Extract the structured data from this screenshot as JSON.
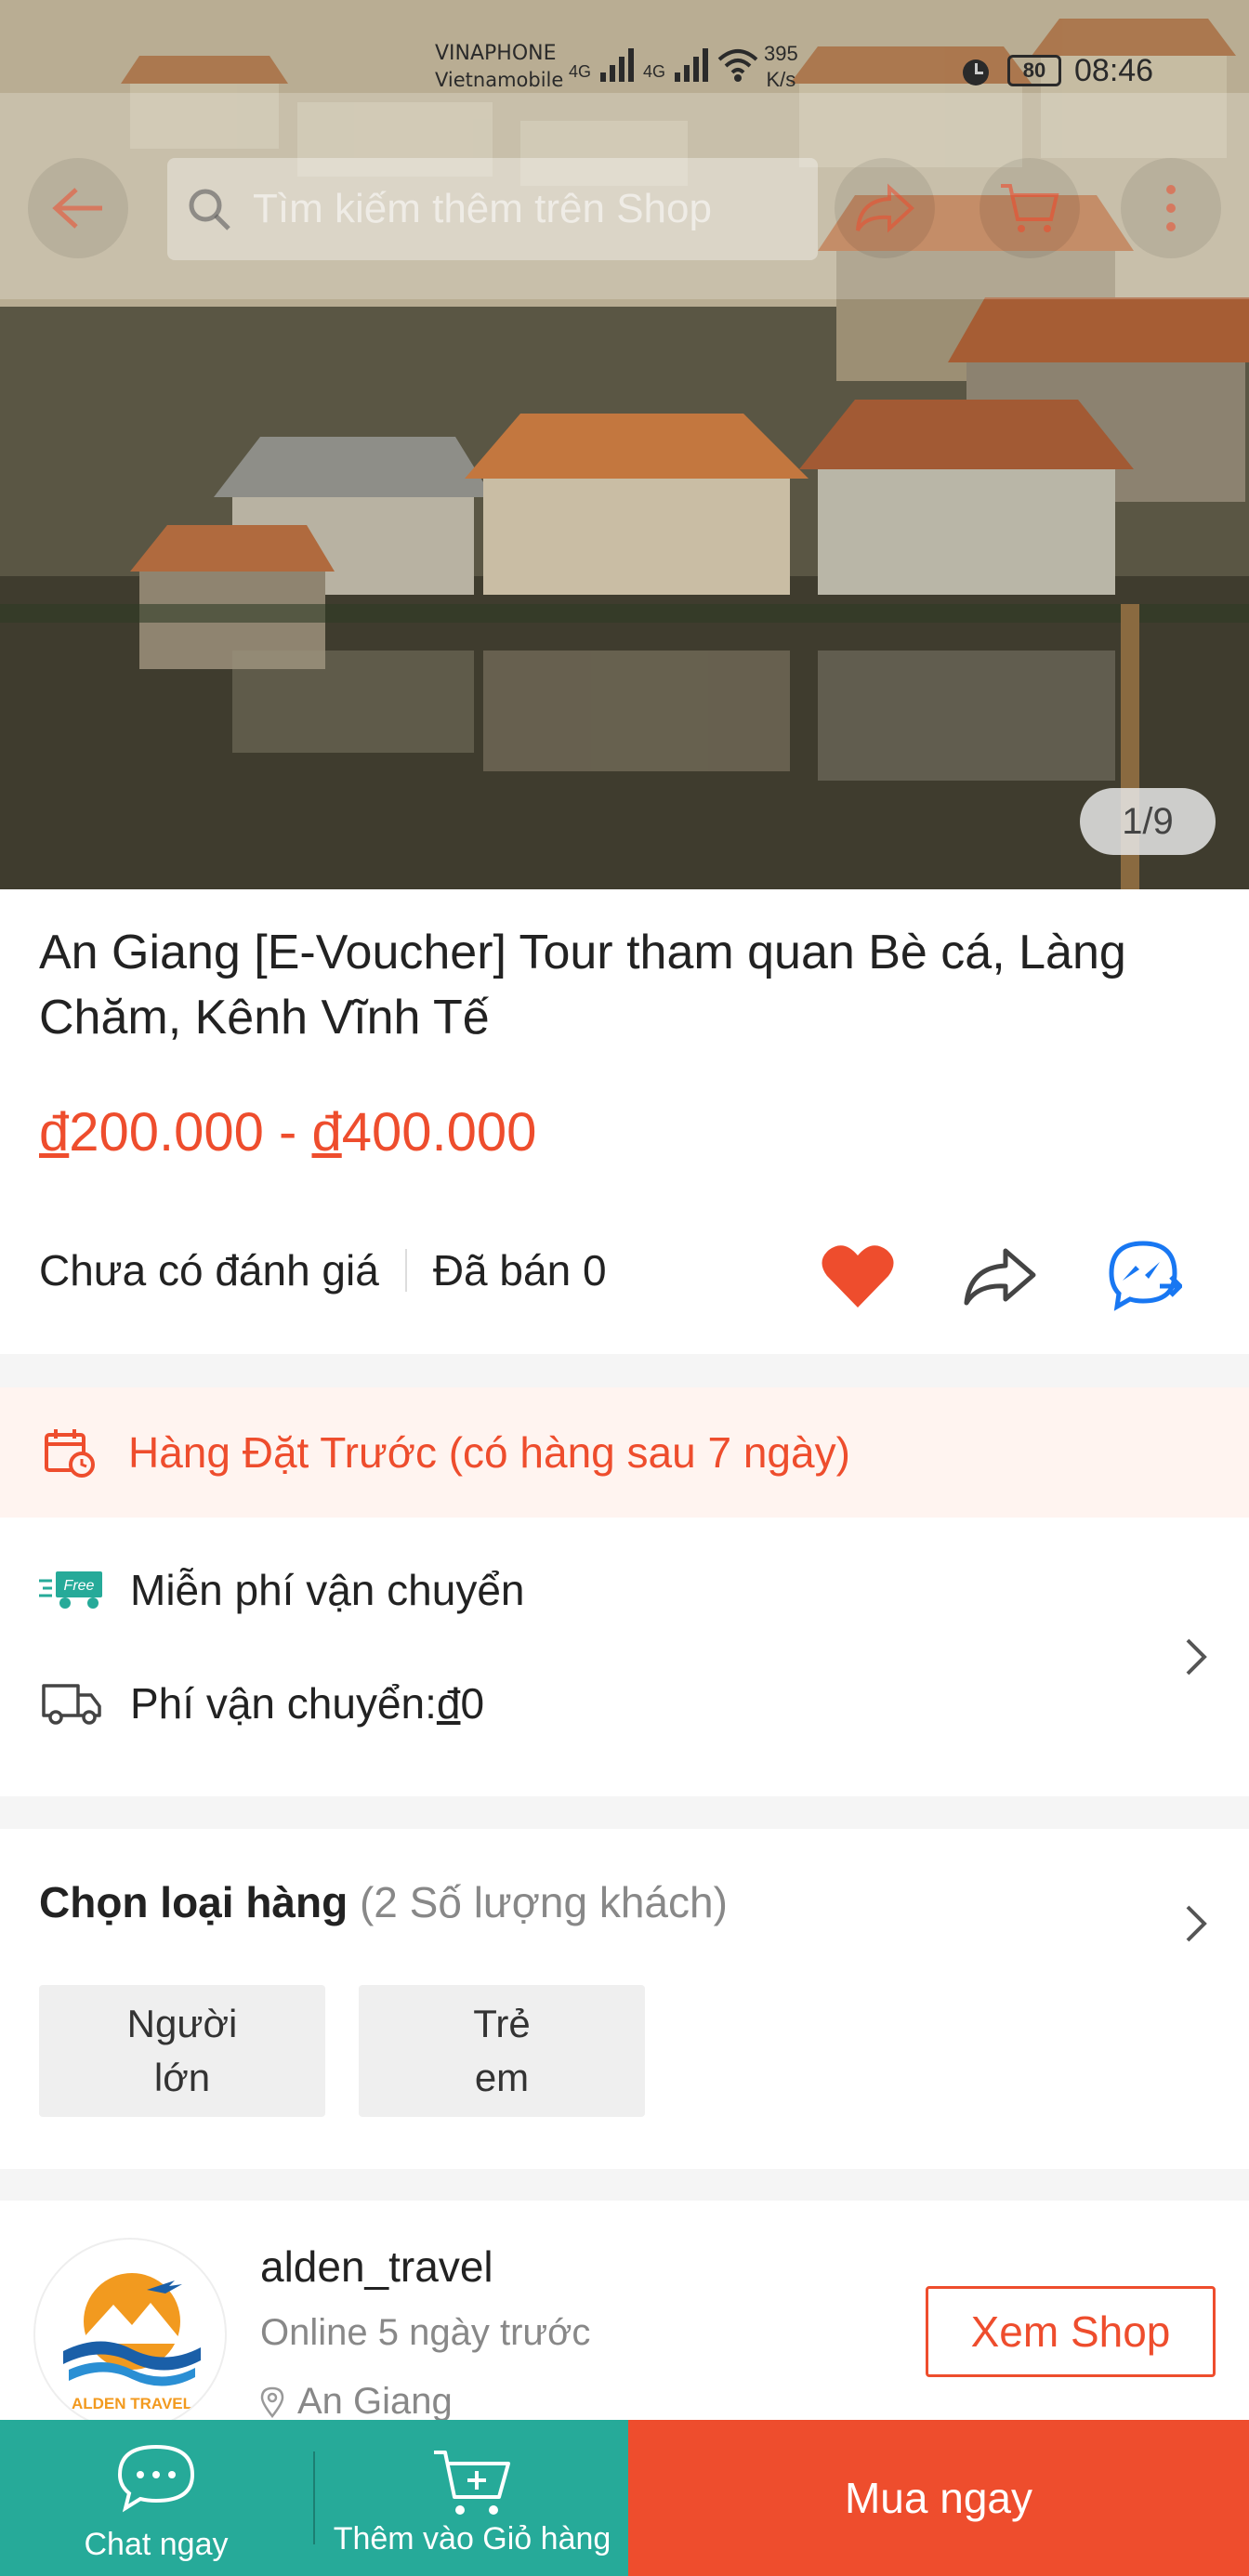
{
  "status_bar": {
    "carrier1": "VINAPHONE",
    "carrier2": "Vietnamobile",
    "net1": "4G",
    "net2": "4G",
    "speed_value": "395",
    "speed_unit": "K/s",
    "battery": "80",
    "time": "08:46"
  },
  "header": {
    "search_placeholder": "Tìm kiếm thêm trên Shop"
  },
  "gallery": {
    "pager": "1/9"
  },
  "product": {
    "title": "An Giang [E-Voucher] Tour tham quan Bè cá, Làng Chăm, Kênh Vĩnh Tế",
    "price_from": "200.000",
    "price_to": "400.000",
    "currency": "đ",
    "rating_text": "Chưa có đánh giá",
    "sold_text": "Đã bán 0"
  },
  "preorder": {
    "text": "Hàng Đặt Trước (có hàng sau 7 ngày)"
  },
  "shipping": {
    "free_badge": "Free",
    "free_text": "Miễn phí vận chuyển",
    "fee_label": "Phí vận chuyển: ",
    "fee_currency": "đ",
    "fee_value": "0"
  },
  "variants": {
    "heading": "Chọn loại hàng",
    "count_text": "(2 Số lượng khách)",
    "options": [
      {
        "line1": "Người",
        "line2": "lớn"
      },
      {
        "line1": "Trẻ",
        "line2": "em"
      }
    ]
  },
  "shop": {
    "name": "alden_travel",
    "online": "Online 5 ngày trước",
    "location": "An Giang",
    "logo_text": "ALDEN TRAVEL",
    "view_button": "Xem Shop"
  },
  "bottom_bar": {
    "chat": "Chat ngay",
    "add_cart": "Thêm vào Giỏ hàng",
    "buy": "Mua ngay"
  },
  "colors": {
    "accent": "#ee4d2d",
    "teal": "#26aa99",
    "preorder_bg": "#fff4f0"
  }
}
